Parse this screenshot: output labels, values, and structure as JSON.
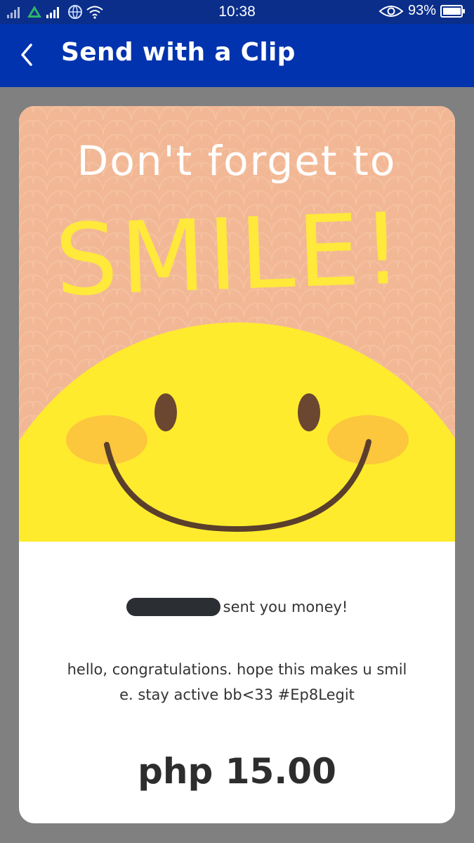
{
  "status_bar": {
    "time": "10:38",
    "battery": "93%",
    "icons": [
      "signal-icon",
      "drive-icon",
      "signal-icon",
      "globe-icon",
      "wifi-icon",
      "eye-icon",
      "battery-icon"
    ]
  },
  "header": {
    "title": "Send with a Clip",
    "back_icon": "chevron-left-icon"
  },
  "clip": {
    "headline": "Don't forget to",
    "big_text": "SMILE!",
    "colors": {
      "background": "#f2b896",
      "face": "#ffeb2e",
      "cheeks": "#fcc63d",
      "features": "#6b4630",
      "text_white": "#ffffff",
      "text_yellow": "#ffe93b"
    }
  },
  "message": {
    "sender_suffix": "sent you money!",
    "body_line1": "hello, congratulations. hope this makes u smil",
    "body_line2": "e. stay active bb<33 #Ep8Legit",
    "amount": "php 15.00"
  }
}
